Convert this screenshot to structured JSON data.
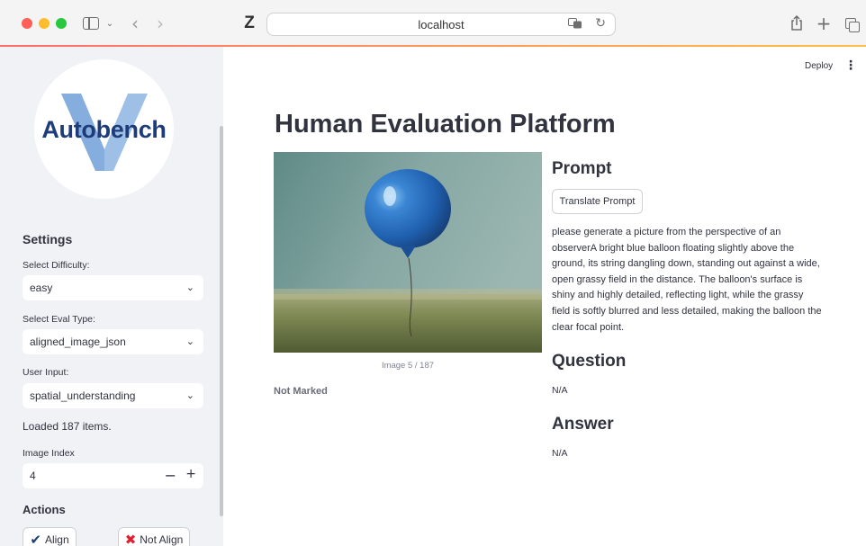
{
  "browser": {
    "url": "localhost"
  },
  "sidebar": {
    "logo_text": "Autobench",
    "settings_heading": "Settings",
    "difficulty": {
      "label": "Select Difficulty:",
      "value": "easy"
    },
    "eval_type": {
      "label": "Select Eval Type:",
      "value": "aligned_image_json"
    },
    "user_input": {
      "label": "User Input:",
      "value": "spatial_understanding"
    },
    "loaded_text": "Loaded 187 items.",
    "image_index": {
      "label": "Image Index",
      "value": "4",
      "minus": "−",
      "plus": "+"
    },
    "actions_heading": "Actions",
    "align_label": "Align",
    "not_align_label": "Not Align"
  },
  "main": {
    "deploy_label": "Deploy",
    "title": "Human Evaluation Platform",
    "image_caption": "Image 5 / 187",
    "status": "Not Marked",
    "prompt_heading": "Prompt",
    "translate_label": "Translate Prompt",
    "prompt_text": "please generate a picture from the perspective of an observerA bright blue balloon floating slightly above the ground, its string dangling down, standing out against a wide, open grassy field in the distance. The balloon's surface is shiny and highly detailed, reflecting light, while the grassy field is softly blurred and less detailed, making the balloon the clear focal point.",
    "question_heading": "Question",
    "question_value": "N/A",
    "answer_heading": "Answer",
    "answer_value": "N/A"
  },
  "colors": {
    "sidebar_bg": "#f0f2f6",
    "text": "#31333f",
    "not_align_icon": "#e0202f",
    "logo_text": "#1e3c7a"
  }
}
